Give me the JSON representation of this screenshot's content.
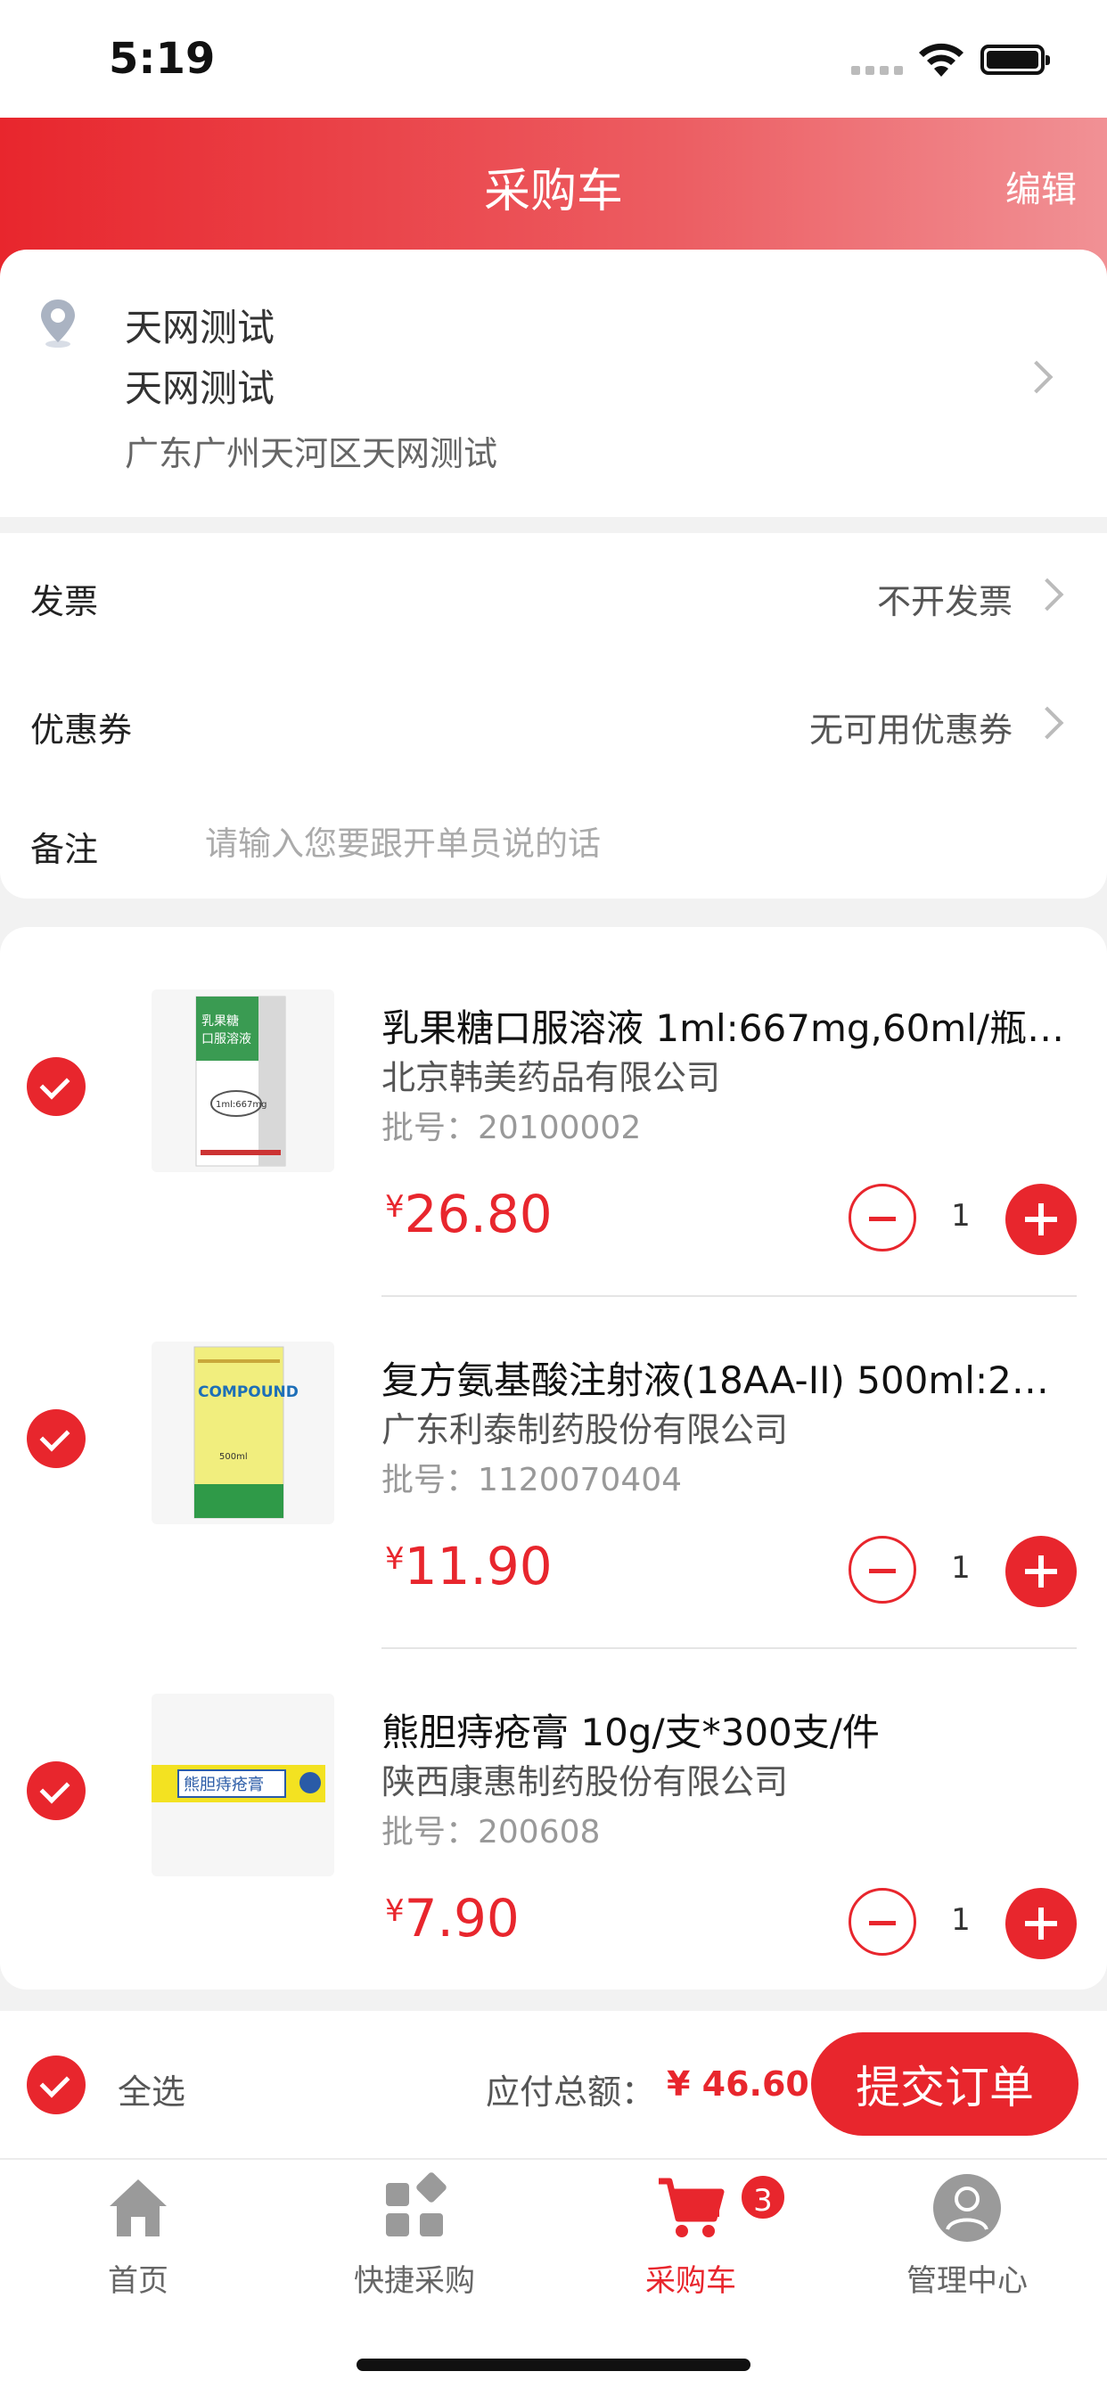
{
  "status_bar": {
    "time": "5:19"
  },
  "header": {
    "title": "采购车",
    "edit_label": "编辑"
  },
  "address": {
    "name": "天网测试",
    "contact": "天网测试",
    "detail": "广东广州天河区天网测试"
  },
  "options": {
    "invoice": {
      "label": "发票",
      "value": "不开发票"
    },
    "coupon": {
      "label": "优惠券",
      "value": "无可用优惠券"
    },
    "remark": {
      "label": "备注",
      "placeholder": "请输入您要跟开单员说的话"
    }
  },
  "products": [
    {
      "name": "乳果糖口服溶液 1ml:667mg,60ml/瓶…",
      "maker": "北京韩美药品有限公司",
      "batch": "批号：20100002",
      "currency": "¥",
      "price": "26.80",
      "qty": "1",
      "thumb_lines": [
        "乳果糖",
        "口服溶液",
        "1ml:667mg"
      ]
    },
    {
      "name": "复方氨基酸注射液(18AA-II) 500ml:2…",
      "maker": "广东利泰制药股份有限公司",
      "batch": "批号：1120070404",
      "currency": "¥",
      "price": "11.90",
      "qty": "1",
      "thumb_lines": [
        "COMPOUND",
        "500ml"
      ]
    },
    {
      "name": "熊胆痔疮膏 10g/支*300支/件",
      "maker": "陕西康惠制药股份有限公司",
      "batch": "批号：200608",
      "currency": "¥",
      "price": "7.90",
      "qty": "1",
      "thumb_lines": [
        "熊胆痔疮膏"
      ]
    }
  ],
  "summary": {
    "select_all_label": "全选",
    "total_label": "应付总额：",
    "total_value": "¥ 46.60",
    "submit_label": "提交订单"
  },
  "tabbar": {
    "items": [
      {
        "label": "首页",
        "icon": "home-icon"
      },
      {
        "label": "快捷采购",
        "icon": "grid-icon"
      },
      {
        "label": "采购车",
        "icon": "cart-icon"
      },
      {
        "label": "管理中心",
        "icon": "user-icon"
      }
    ],
    "cart_badge": "3"
  },
  "colors": {
    "accent": "#e8262d",
    "page_bg": "#f2f2f2"
  }
}
